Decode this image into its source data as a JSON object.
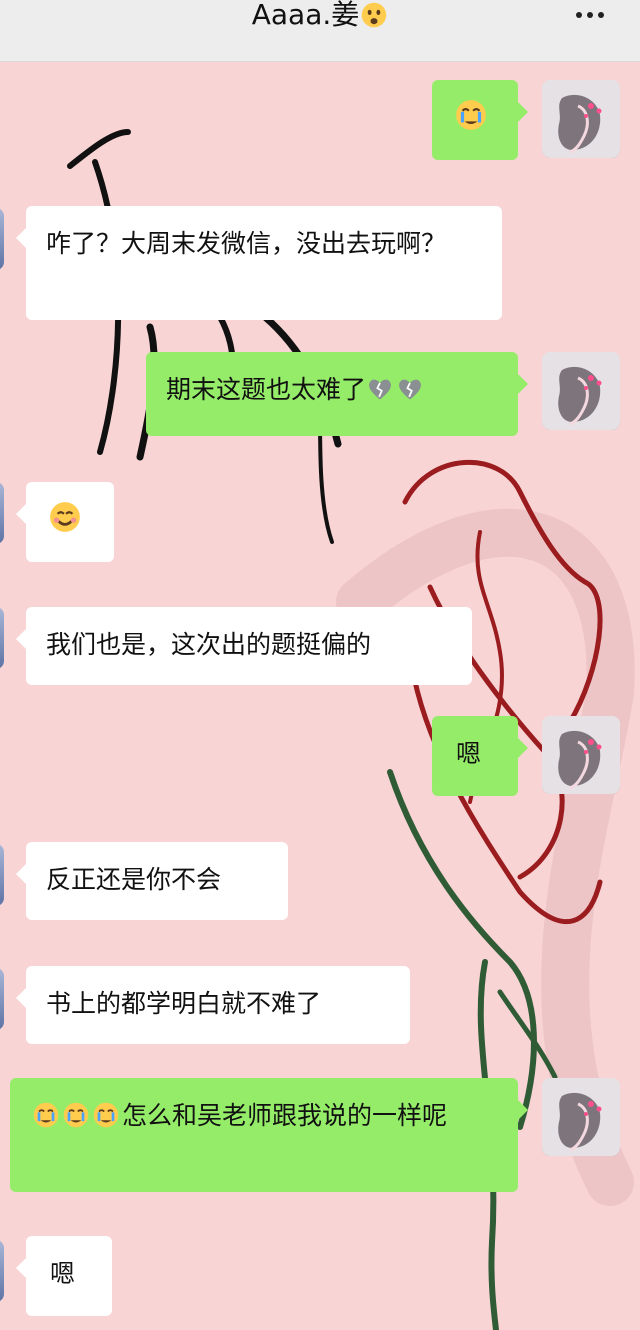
{
  "header": {
    "title": "Aaaa.姜",
    "title_emoji": "astonished-face"
  },
  "messages": [
    {
      "side": "outgoing",
      "text": "",
      "emoji": [
        "crying-face"
      ]
    },
    {
      "side": "incoming",
      "text": "咋了？大周末发微信，没出去玩啊？",
      "emoji": []
    },
    {
      "side": "outgoing",
      "text": "期末这题也太难了",
      "emoji": [
        "broken-heart",
        "broken-heart"
      ]
    },
    {
      "side": "incoming",
      "text": "",
      "emoji": [
        "smiling-face"
      ]
    },
    {
      "side": "incoming",
      "text": "我们也是，这次出的题挺偏的",
      "emoji": []
    },
    {
      "side": "outgoing",
      "text": "嗯",
      "emoji": []
    },
    {
      "side": "incoming",
      "text": "反正还是你不会",
      "emoji": []
    },
    {
      "side": "incoming",
      "text": "书上的都学明白就不难了",
      "emoji": []
    },
    {
      "side": "outgoing",
      "text": "怎么和吴老师跟我说的一样呢",
      "emoji": [
        "crying-face",
        "crying-face",
        "crying-face"
      ]
    },
    {
      "side": "incoming",
      "text": "嗯",
      "emoji": []
    }
  ],
  "colors": {
    "header_bg": "#ededed",
    "chat_bg": "#f8d4d5",
    "outgoing_bubble": "#95ec69",
    "incoming_bubble": "#ffffff",
    "text": "#111111"
  }
}
